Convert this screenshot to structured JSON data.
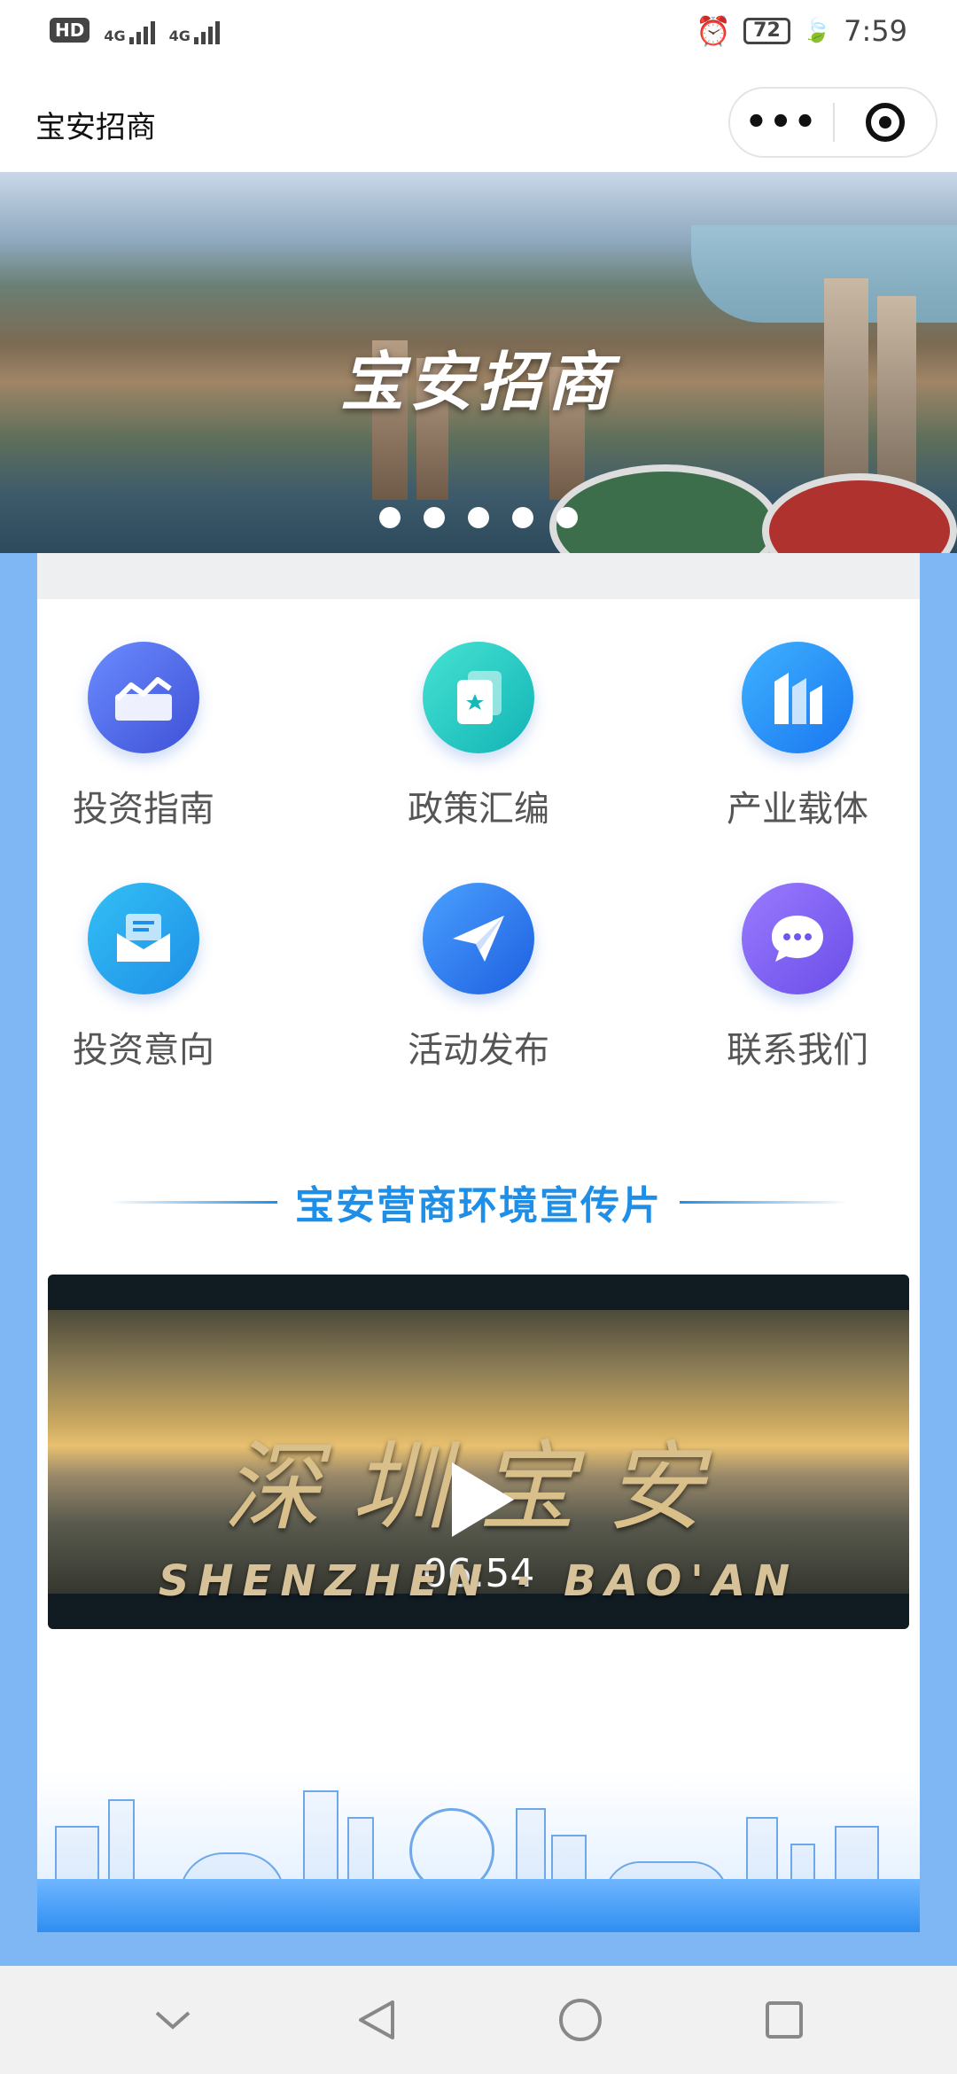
{
  "status_bar": {
    "network_left": "HD",
    "sim1": "4G",
    "sim2": "4G",
    "battery": "72",
    "time": "7:59",
    "icons": [
      "hd-icon",
      "signal-icon",
      "alarm-icon",
      "battery-icon",
      "leaf-icon"
    ]
  },
  "nav": {
    "title": "宝安招商",
    "more_label": "•••",
    "icons": [
      "more-icon",
      "close-target-icon"
    ]
  },
  "banner": {
    "headline": "宝安招商",
    "slide_count": 5,
    "active_slide": 1
  },
  "menu": {
    "items": [
      {
        "label": "投资指南",
        "icon": "chart-icon",
        "color": "#4e6cf0"
      },
      {
        "label": "政策汇编",
        "icon": "star-card-icon",
        "color": "#20c6c2"
      },
      {
        "label": "产业载体",
        "icon": "buildings-icon",
        "color": "#1e8ef2"
      },
      {
        "label": "投资意向",
        "icon": "envelope-icon",
        "color": "#1fa0ec"
      },
      {
        "label": "活动发布",
        "icon": "paper-plane-icon",
        "color": "#2b76ea"
      },
      {
        "label": "联系我们",
        "icon": "chat-bubble-icon",
        "color": "#7b5cf2"
      }
    ]
  },
  "section": {
    "title": "宝安营商环境宣传片"
  },
  "video": {
    "title_cn": "深圳宝安",
    "title_en": "SHENZHEN · BAO'AN",
    "duration": "06:54",
    "icons": [
      "play-icon"
    ]
  },
  "system_nav": {
    "icons": [
      "chevron-down-icon",
      "back-triangle-icon",
      "home-circle-icon",
      "recents-square-icon"
    ]
  },
  "colors": {
    "accent": "#1f8ee6",
    "page_bg": "#7fb6f4"
  }
}
